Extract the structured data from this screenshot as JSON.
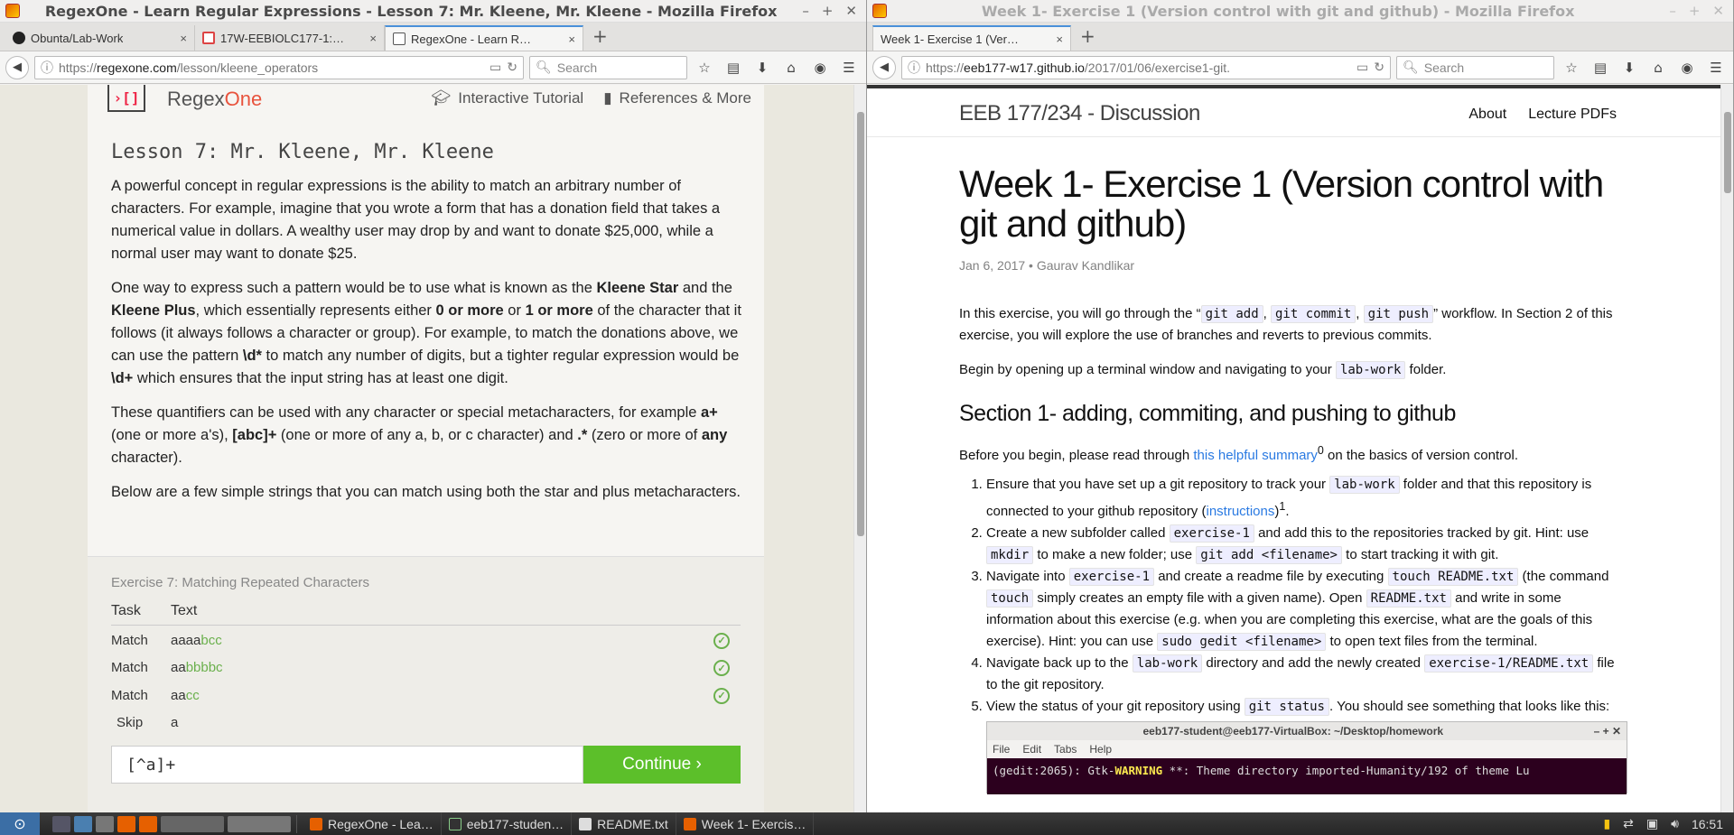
{
  "left_window": {
    "title": "RegexOne - Learn Regular Expressions - Lesson 7: Mr. Kleene, Mr. Kleene - Mozilla Firefox",
    "tabs": [
      {
        "label": "Obunta/Lab-Work",
        "close": "×"
      },
      {
        "label": "17W-EEBIOLC177-1:…",
        "close": "×"
      },
      {
        "label": "RegexOne - Learn R…",
        "close": "×"
      }
    ],
    "new_tab": "+",
    "url_prefix": "https://",
    "url_domain": "regexone.com",
    "url_path": "/lesson/kleene_operators",
    "search_placeholder": "Search"
  },
  "regexone": {
    "brand_a": "Regex",
    "brand_b": "One",
    "logo": "›[]",
    "nav_tutorial": "Interactive Tutorial",
    "nav_references": "References & More",
    "lesson_title": "Lesson 7: Mr. Kleene, Mr. Kleene",
    "p1": "A powerful concept in regular expressions is the ability to match an arbitrary number of characters. For example, imagine that you wrote a form that has a donation field that takes a numerical value in dollars. A wealthy user may drop by and want to donate $25,000, while a normal user may want to donate $25.",
    "p2_a": "One way to express such a pattern would be to use what is known as the ",
    "p2_b": "Kleene Star",
    "p2_c": " and the ",
    "p2_d": "Kleene Plus",
    "p2_e": ", which essentially represents either ",
    "p2_f": "0 or more",
    "p2_g": " or ",
    "p2_h": "1 or more",
    "p2_i": " of the character that it follows (it always follows a character or group). For example, to match the donations above, we can use the pattern ",
    "p2_j": "\\d*",
    "p2_k": " to match any number of digits, but a tighter regular expression would be ",
    "p2_l": "\\d+",
    "p2_m": " which ensures that the input string has at least one digit.",
    "p3_a": "These quantifiers can be used with any character or special metacharacters, for example ",
    "p3_b": "a+",
    "p3_c": " (one or more a's), ",
    "p3_d": "[abc]+",
    "p3_e": " (one or more of any a, b, or c character) and ",
    "p3_f": ".*",
    "p3_g": " (zero or more of ",
    "p3_h": "any",
    "p3_i": " character).",
    "p4": "Below are a few simple strings that you can match using both the star and plus metacharacters.",
    "exercise_title": "Exercise 7: Matching Repeated Characters",
    "col_task": "Task",
    "col_text": "Text",
    "rows": [
      {
        "task": "Match",
        "plain": "aaaa",
        "matched": "bcc",
        "check": "✓"
      },
      {
        "task": "Match",
        "plain": "aa",
        "matched": "bbbbc",
        "check": "✓"
      },
      {
        "task": "Match",
        "plain": "aa",
        "matched": "cc",
        "check": "✓"
      },
      {
        "task": "Skip",
        "plain": "a",
        "matched": "",
        "check": ""
      }
    ],
    "input_value": "[^a]+",
    "continue_label": "Continue ›",
    "colors": {
      "accent": "#5cbf2a",
      "brand": "#e8533d"
    }
  },
  "right_window": {
    "title": "Week 1- Exercise 1 (Version control with git and github) - Mozilla Firefox",
    "tabs": [
      {
        "label": "Week 1- Exercise 1 (Ver…",
        "close": "×"
      }
    ],
    "new_tab": "+",
    "url_prefix": "https://",
    "url_domain": "eeb177-w17.github.io",
    "url_path": "/2017/01/06/exercise1-git.",
    "search_placeholder": "Search"
  },
  "blog": {
    "site_title": "EEB 177/234 - Discussion",
    "menu_about": "About",
    "menu_pdfs": "Lecture PDFs",
    "post_title": "Week 1- Exercise 1 (Version control with git and github)",
    "meta": "Jan 6, 2017 • Gaurav Kandlikar",
    "intro_a": "In this exercise, you will go through the “",
    "intro_code1": "git add",
    "intro_sep": ", ",
    "intro_code2": "git commit",
    "intro_code3": "git push",
    "intro_b": "” workflow. In Section 2 of this exercise, you will explore the use of branches and reverts to previous commits.",
    "begin_a": "Begin by opening up a terminal window and navigating to your ",
    "begin_code": "lab-work",
    "begin_b": " folder.",
    "section1": "Section 1- adding, commiting, and pushing to github",
    "before_a": "Before you begin, please read through ",
    "before_link": "this helpful summary",
    "before_sup": "0",
    "before_b": " on the basics of version control.",
    "li1_a": "Ensure that you have set up a git repository to track your ",
    "li1_code": "lab-work",
    "li1_b": " folder and that this repository is connected to your github repository (",
    "li1_link": "instructions",
    "li1_c": ")",
    "li1_sup": "1",
    "li1_d": ".",
    "li2_a": "Create a new subfolder called ",
    "li2_code1": "exercise-1",
    "li2_b": " and add this to the repositories tracked by git. Hint: use ",
    "li2_code2": "mkdir",
    "li2_c": " to make a new folder; use ",
    "li2_code3": "git add <filename>",
    "li2_d": " to start tracking it with git.",
    "li3_a": "Navigate into ",
    "li3_code1": "exercise-1",
    "li3_b": " and create a readme file by executing ",
    "li3_code2": "touch README.txt",
    "li3_c": " (the command ",
    "li3_code3": "touch",
    "li3_d": " simply creates an empty file with a given name). Open ",
    "li3_code4": "README.txt",
    "li3_e": " and write in some information about this exercise (e.g. when you are completing this exercise, what are the goals of this exercise). Hint: you can use ",
    "li3_code5": "sudo gedit <filename>",
    "li3_f": " to open text files from the terminal.",
    "li4_a": "Navigate back up to the ",
    "li4_code1": "lab-work",
    "li4_b": " directory and add the newly created ",
    "li4_code2": "exercise-1/README.txt",
    "li4_c": " file to the git repository.",
    "li5_a": "View the status of your git repository using ",
    "li5_code": "git status",
    "li5_b": ". You should see something that looks like this:",
    "term_title": "eeb177-student@eeb177-VirtualBox: ~/Desktop/homework",
    "term_menu": [
      "File",
      "Edit",
      "Tabs",
      "Help"
    ],
    "term_line_a": "(gedit:2065): Gtk-",
    "term_line_warn": "WARNING",
    "term_line_b": " **: Theme directory  imported-Humanity/192 of theme Lu"
  },
  "taskbar": {
    "tasks": [
      "RegexOne - Lea…",
      "eeb177-studen…",
      "README.txt",
      "Week 1- Exercis…"
    ],
    "clock": "16:51"
  }
}
